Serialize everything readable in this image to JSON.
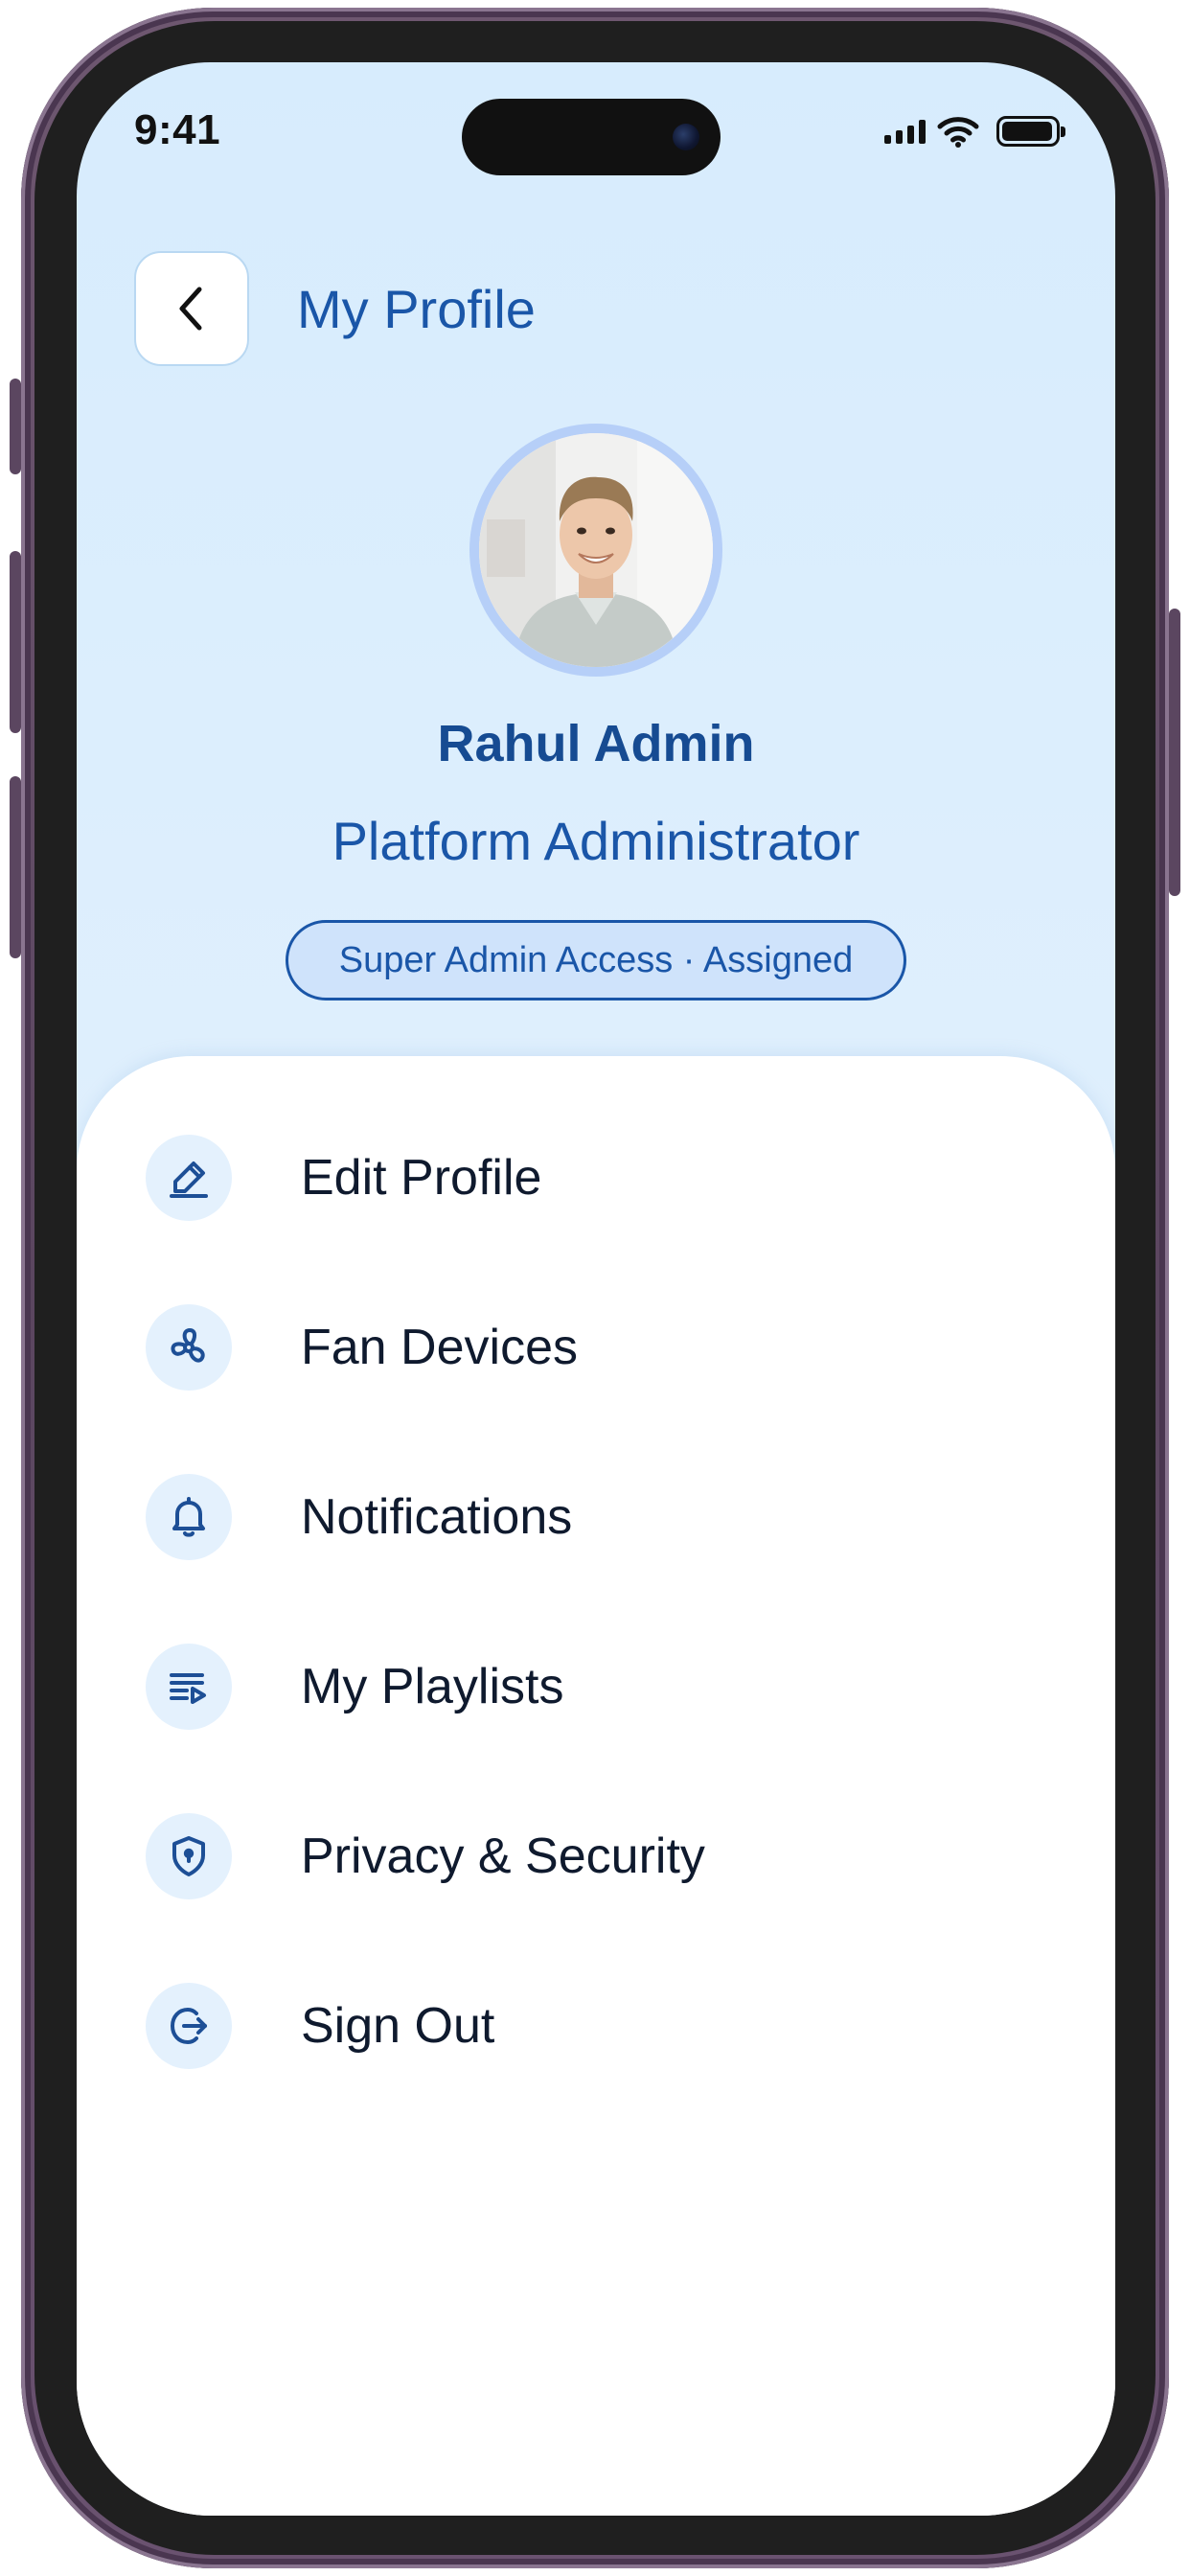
{
  "status_bar": {
    "time": "9:41"
  },
  "header": {
    "title": "My Profile",
    "back_icon": "chevron-left-icon"
  },
  "profile": {
    "name": "Rahul Admin",
    "role": "Platform Administrator",
    "badge": "Super Admin Access · Assigned"
  },
  "menu": {
    "items": [
      {
        "label": "Edit Profile",
        "icon": "pencil-icon"
      },
      {
        "label": "Fan Devices",
        "icon": "fan-icon"
      },
      {
        "label": "Notifications",
        "icon": "bell-icon"
      },
      {
        "label": "My Playlists",
        "icon": "playlist-icon"
      },
      {
        "label": "Privacy & Security",
        "icon": "shield-lock-icon"
      },
      {
        "label": "Sign Out",
        "icon": "sign-out-icon"
      }
    ]
  },
  "colors": {
    "accent": "#1a56a8",
    "header_gradient_top": "#d7ecfd",
    "icon_bg": "#e4f1fd",
    "badge_bg": "#cfe3fb",
    "phone_frame": "#5b4660"
  }
}
